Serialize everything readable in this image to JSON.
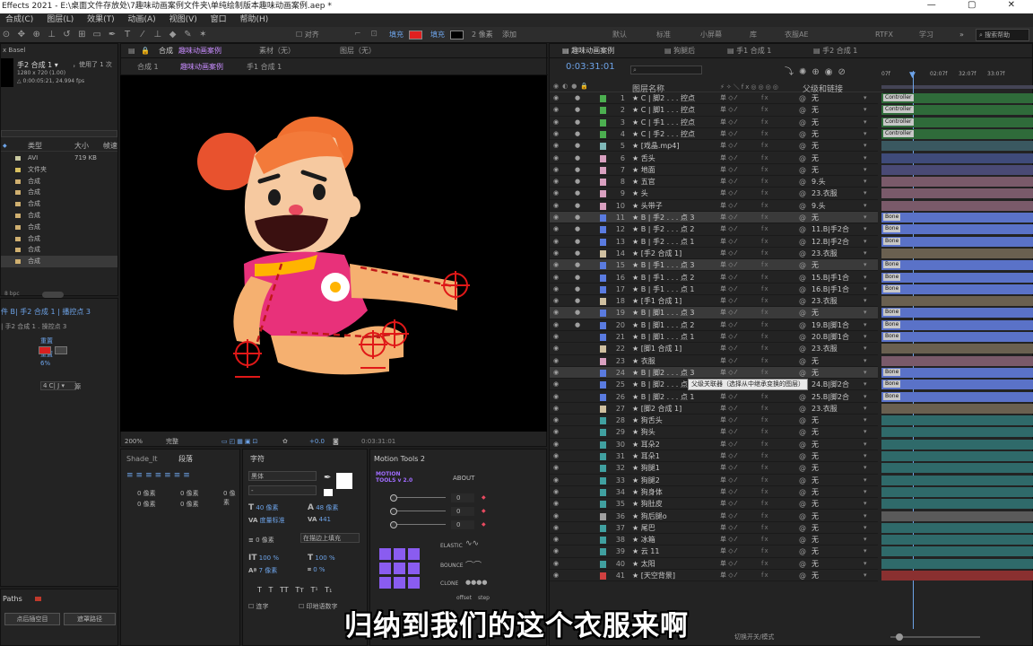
{
  "window": {
    "title": "Effects 2021 - E:\\桌面文件存放处\\7趣味动画案例文件夹\\单纯绘制版本趣味动画案例.aep *",
    "controls": [
      "—",
      "▢",
      "✕"
    ]
  },
  "menu": [
    "合成(C)",
    "图层(L)",
    "效果(T)",
    "动画(A)",
    "视图(V)",
    "窗口",
    "帮助(H)"
  ],
  "toolbar": {
    "align_label": "对齐",
    "fill_label": "填充",
    "fill_color": "#e02020",
    "stroke_label": "描边",
    "stroke_width": "2 像素",
    "add_label": "添加",
    "workspaces": [
      "默认",
      "标准",
      "小屏幕",
      "库",
      "衣服AE",
      "RTFX",
      "学习"
    ],
    "search_help": "搜索帮助"
  },
  "project": {
    "label": "x Basel",
    "comp_name": "手2 合成 1 ▾",
    "used": "，使用了 1 次",
    "size": "1280 x 720 (1.00)",
    "duration": "△ 0:00:05:21, 24.994 fps",
    "col_type": "类型",
    "col_size": "大小",
    "col_rate": "帧速",
    "items": [
      {
        "type": "AVI",
        "size": "719 KB",
        "color": "#c8c8a0"
      },
      {
        "type": "文件夹",
        "size": "",
        "color": "#d8c060"
      },
      {
        "type": "合成",
        "size": "",
        "color": "#d0b070"
      },
      {
        "type": "合成",
        "size": "",
        "color": "#d0b070"
      },
      {
        "type": "合成",
        "size": "",
        "color": "#d0b070"
      },
      {
        "type": "合成",
        "size": "",
        "color": "#d0b070"
      },
      {
        "type": "合成",
        "size": "",
        "color": "#d0b070"
      },
      {
        "type": "合成",
        "size": "",
        "color": "#d0b070"
      },
      {
        "type": "合成",
        "size": "",
        "color": "#d0b070"
      },
      {
        "type": "合成",
        "size": "",
        "color": "#d0b070"
      }
    ],
    "bpc": "8 bpc"
  },
  "effects_panel": {
    "breadcrumb": "件 B| 手2 合成 1 | 播控点 3",
    "sub": "| 手2 合成 1 . 操控点 3",
    "prop1": "重置",
    "prop2": "重置",
    "percent": "6%",
    "menu_value": "4 C|  J ▾",
    "mode": "源"
  },
  "paths_panel": {
    "title": "Paths",
    "btn1": "点后插空目",
    "btn2": "遮罩路径"
  },
  "comp_panel": {
    "tab_comp_label": "合成",
    "tab_comp": "趣味动画案例",
    "tab_footage": "素材（无）",
    "tab_layer": "图层（无）",
    "sub_tabs": [
      "合成 1",
      "趣味动画案例",
      "手1 合成 1"
    ],
    "zoom": "200%",
    "quality": "完整",
    "exposure": "+0.0",
    "timecode": "0:03:31:01"
  },
  "lower_panels": {
    "shade_label": "Shade_It",
    "paragraph_label": "段落",
    "indent_values": [
      "0 像素",
      "0 像素",
      "0 像素",
      "0 像素",
      "0 像素"
    ],
    "char_label": "字符",
    "font": "黑体",
    "font_style": "-",
    "font_size": "40 像素",
    "leading": "48 像素",
    "kerning": "度量标准",
    "tracking": "441",
    "stroke_size": "0 像素",
    "stroke_mode": "在描边上填充",
    "vscale": "100 %",
    "hscale": "100 %",
    "baseline": "7 像素",
    "tsume": "0 %",
    "ligature_label": "连字",
    "hindi_label": "印地语数字",
    "text_styles": [
      "T",
      "T",
      "TT",
      "Tт",
      "T¹",
      "T₁"
    ]
  },
  "motion_tools": {
    "title": "Motion Tools 2",
    "logo": "MOTION TOOLS v 2.0",
    "about": "ABOUT",
    "slider_values": [
      "0",
      "0",
      "0"
    ],
    "elastic": "ELASTIC",
    "bounce": "BOUNCE",
    "clone": "CLONE",
    "offset": "offset",
    "step": "step"
  },
  "timeline": {
    "tabs": [
      "趣味动画案例",
      "狗腿后",
      "手1 合成 1",
      "手2 合成 1"
    ],
    "timecode": "0:03:31:01",
    "col_name": "图层名称",
    "col_parent": "父级和链接",
    "ruler": [
      "07f",
      "02:07f",
      "32:07f",
      "33:07f"
    ],
    "switches_label": "切换开关/模式",
    "tooltip": "父级关联器（选择从中继承变换的图层）",
    "layers": [
      {
        "num": "1",
        "name": "C | 脚2 . . . 控点",
        "color": "#4caf50",
        "parent": "无",
        "bar": "#2f6b3a",
        "tag": "Controller"
      },
      {
        "num": "2",
        "name": "C | 脚1 . . . 控点",
        "color": "#4caf50",
        "parent": "无",
        "bar": "#2f6b3a",
        "tag": "Controller"
      },
      {
        "num": "3",
        "name": "C | 手1 . . . 控点",
        "color": "#4caf50",
        "parent": "无",
        "bar": "#2f6b3a",
        "tag": "Controller"
      },
      {
        "num": "4",
        "name": "C | 手2 . . . 控点",
        "color": "#4caf50",
        "parent": "无",
        "bar": "#2f6b3a",
        "tag": "Controller"
      },
      {
        "num": "5",
        "name": "[戏晶.mp4]",
        "color": "#7fb8b8",
        "parent": "无",
        "bar": "#3a5860",
        "tag": ""
      },
      {
        "num": "6",
        "name": "舌头",
        "color": "#d9a0c0",
        "parent": "无",
        "bar": "#3f4b7a",
        "tag": ""
      },
      {
        "num": "7",
        "name": "地面",
        "color": "#d9a0c0",
        "parent": "无",
        "bar": "#4a4a75",
        "tag": ""
      },
      {
        "num": "8",
        "name": "五官",
        "color": "#d9a0c0",
        "parent": "9.头",
        "bar": "#7a5a6a",
        "tag": ""
      },
      {
        "num": "9",
        "name": "头",
        "color": "#d9a0c0",
        "parent": "23.衣服",
        "bar": "#7a5a6a",
        "tag": ""
      },
      {
        "num": "10",
        "name": "头带子",
        "color": "#d9a0c0",
        "parent": "9.头",
        "bar": "#7a5a6a",
        "tag": ""
      },
      {
        "num": "11",
        "name": "B | 手2 . . . 点 3",
        "color": "#5a7be0",
        "parent": "无",
        "bar": "#5a72c8",
        "tag": "Bone"
      },
      {
        "num": "12",
        "name": "B | 手2 . . . 点 2",
        "color": "#5a7be0",
        "parent": "11.B|手2合",
        "bar": "#5a72c8",
        "tag": "Bone"
      },
      {
        "num": "13",
        "name": "B | 手2 . . . 点 1",
        "color": "#5a7be0",
        "parent": "12.B|手2合",
        "bar": "#5a72c8",
        "tag": "Bone"
      },
      {
        "num": "14",
        "name": "[手2 合成 1]",
        "color": "#d0c0a0",
        "parent": "23.衣服",
        "bar": "#6a6050",
        "tag": ""
      },
      {
        "num": "15",
        "name": "B | 手1 . . . 点 3",
        "color": "#5a7be0",
        "parent": "无",
        "bar": "#5a72c8",
        "tag": "Bone"
      },
      {
        "num": "16",
        "name": "B | 手1 . . . 点 2",
        "color": "#5a7be0",
        "parent": "15.B|手1合",
        "bar": "#5a72c8",
        "tag": "Bone"
      },
      {
        "num": "17",
        "name": "B | 手1 . . . 点 1",
        "color": "#5a7be0",
        "parent": "16.B|手1合",
        "bar": "#5a72c8",
        "tag": "Bone"
      },
      {
        "num": "18",
        "name": "[手1 合成 1]",
        "color": "#d0c0a0",
        "parent": "23.衣服",
        "bar": "#6a6050",
        "tag": ""
      },
      {
        "num": "19",
        "name": "B | 脚1 . . . 点 3",
        "color": "#5a7be0",
        "parent": "无",
        "bar": "#5a72c8",
        "tag": "Bone"
      },
      {
        "num": "20",
        "name": "B | 脚1 . . . 点 2",
        "color": "#5a7be0",
        "parent": "19.B|脚1合",
        "bar": "#5a72c8",
        "tag": "Bone"
      },
      {
        "num": "21",
        "name": "B | 脚1 . . . 点 1",
        "color": "#5a7be0",
        "parent": "20.B|脚1合",
        "bar": "#5a72c8",
        "tag": "Bone"
      },
      {
        "num": "22",
        "name": "[脚1 合成 1]",
        "color": "#d0c0a0",
        "parent": "23.衣服",
        "bar": "#6a6050",
        "tag": ""
      },
      {
        "num": "23",
        "name": "衣服",
        "color": "#d9a0c0",
        "parent": "无",
        "bar": "#7a5a6a",
        "tag": ""
      },
      {
        "num": "24",
        "name": "B | 脚2 . . . 点 3",
        "color": "#5a7be0",
        "parent": "无",
        "bar": "#5a72c8",
        "tag": "Bone"
      },
      {
        "num": "25",
        "name": "B | 脚2 . . . 点 2",
        "color": "#5a7be0",
        "parent": "24.B|脚2合",
        "bar": "#5a72c8",
        "tag": "Bone"
      },
      {
        "num": "26",
        "name": "B | 脚2 . . . 点 1",
        "color": "#5a7be0",
        "parent": "25.B|脚2合",
        "bar": "#5a72c8",
        "tag": "Bone"
      },
      {
        "num": "27",
        "name": "[脚2 合成 1]",
        "color": "#d0c0a0",
        "parent": "23.衣服",
        "bar": "#6a6050",
        "tag": ""
      },
      {
        "num": "28",
        "name": "狗舌头",
        "color": "#40a0a0",
        "parent": "无",
        "bar": "#2f6a6a",
        "tag": ""
      },
      {
        "num": "29",
        "name": "狗头",
        "color": "#40a0a0",
        "parent": "无",
        "bar": "#2f6a6a",
        "tag": ""
      },
      {
        "num": "30",
        "name": "耳朵2",
        "color": "#40a0a0",
        "parent": "无",
        "bar": "#2f6a6a",
        "tag": ""
      },
      {
        "num": "31",
        "name": "耳朵1",
        "color": "#40a0a0",
        "parent": "无",
        "bar": "#2f6a6a",
        "tag": ""
      },
      {
        "num": "32",
        "name": "狗腿1",
        "color": "#40a0a0",
        "parent": "无",
        "bar": "#2f6a6a",
        "tag": ""
      },
      {
        "num": "33",
        "name": "狗腿2",
        "color": "#40a0a0",
        "parent": "无",
        "bar": "#2f6a6a",
        "tag": ""
      },
      {
        "num": "34",
        "name": "狗身体",
        "color": "#40a0a0",
        "parent": "无",
        "bar": "#2f6a6a",
        "tag": ""
      },
      {
        "num": "35",
        "name": "狗肚皮",
        "color": "#40a0a0",
        "parent": "无",
        "bar": "#2f6a6a",
        "tag": ""
      },
      {
        "num": "36",
        "name": "狗后腿o",
        "color": "#a0a0a0",
        "parent": "无",
        "bar": "#5a5a5a",
        "tag": ""
      },
      {
        "num": "37",
        "name": "尾巴",
        "color": "#40a0a0",
        "parent": "无",
        "bar": "#2f6a6a",
        "tag": ""
      },
      {
        "num": "38",
        "name": "冰箱",
        "color": "#40a0a0",
        "parent": "无",
        "bar": "#2f6a6a",
        "tag": ""
      },
      {
        "num": "39",
        "name": "云 11",
        "color": "#40a0a0",
        "parent": "无",
        "bar": "#2f6a6a",
        "tag": ""
      },
      {
        "num": "40",
        "name": "太阳",
        "color": "#40a0a0",
        "parent": "无",
        "bar": "#2f6a6a",
        "tag": ""
      },
      {
        "num": "41",
        "name": "[天空背景]",
        "color": "#d04040",
        "parent": "无",
        "bar": "#8a3030",
        "tag": ""
      }
    ]
  },
  "subtitle": "归纳到我们的这个衣服来啊"
}
